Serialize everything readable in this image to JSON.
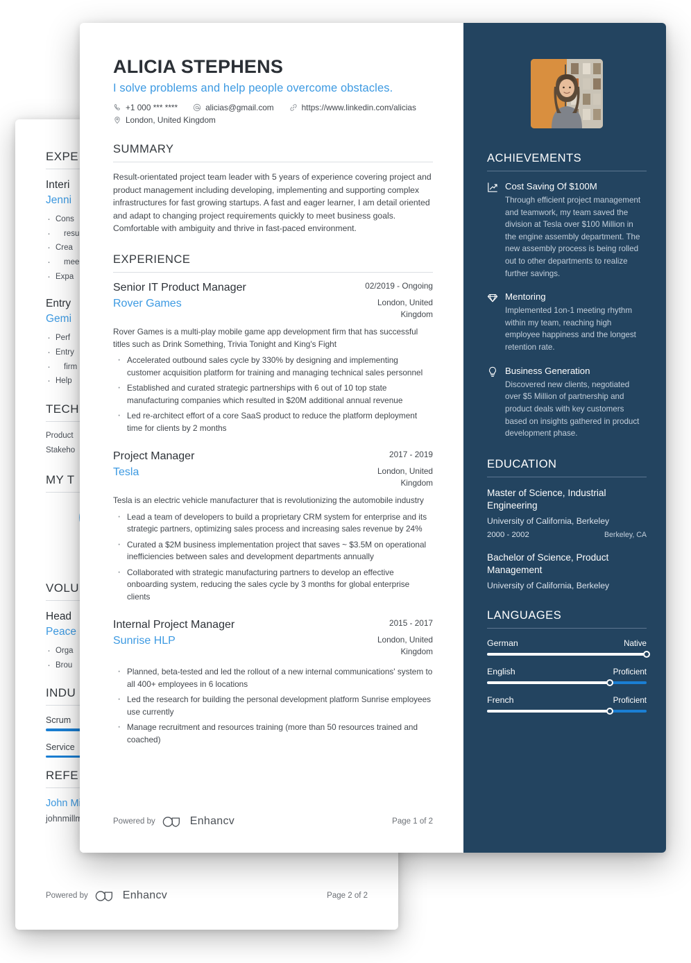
{
  "front_page": {
    "header": {
      "name": "ALICIA STEPHENS",
      "tagline": "I solve problems and help people overcome obstacles.",
      "contacts": [
        {
          "icon": "phone-icon",
          "text": "+1 000 *** ****"
        },
        {
          "icon": "email-icon",
          "text": "alicias@gmail.com"
        },
        {
          "icon": "link-icon",
          "text": "https://www.linkedin.com/alicias"
        },
        {
          "icon": "location-pin-icon",
          "text": "London, United Kingdom"
        }
      ]
    },
    "summary": {
      "heading": "SUMMARY",
      "text": "Result-orientated project team leader with 5 years of experience covering project and product management including developing, implementing and supporting complex infrastructures for fast growing startups. A fast and eager learner, I am detail oriented and adapt to changing project requirements quickly to meet business goals. Comfortable with ambiguity and thrive in fast-paced environment."
    },
    "experience": {
      "heading": "EXPERIENCE",
      "jobs": [
        {
          "title": "Senior IT Product Manager",
          "company": "Rover Games",
          "date": "02/2019 - Ongoing",
          "location": "London, United Kingdom",
          "description": "Rover Games is a multi-play mobile game app development firm that has successful titles such as Drink Something, Trivia Tonight and King's Fight",
          "bullets": [
            "Accelerated outbound sales cycle by 330% by designing and implementing customer acquisition platform for training and managing technical sales personnel",
            "Established and curated strategic partnerships with 6 out of 10 top state manufacturing companies which resulted in $20M additional annual revenue",
            "Led re-architect effort of a core SaaS product to reduce the platform deployment time for clients by 2 months"
          ]
        },
        {
          "title": "Project Manager",
          "company": "Tesla",
          "date": "2017 - 2019",
          "location": "London, United Kingdom",
          "description": "Tesla is an electric vehicle manufacturer that is revolutionizing the automobile industry",
          "bullets": [
            "Lead a team of developers to build a proprietary CRM system for enterprise and its strategic partners, optimizing sales process and increasing sales revenue by 24%",
            "Curated a $2M business implementation project that saves ~ $3.5M on operational inefficiencies between sales and development departments annually",
            "Collaborated with strategic manufacturing partners to develop an effective onboarding system, reducing the sales cycle by 3 months for global enterprise clients"
          ]
        },
        {
          "title": "Internal Project Manager",
          "company": "Sunrise HLP",
          "date": "2015 - 2017",
          "location": "London, United Kingdom",
          "description": "",
          "bullets": [
            "Planned, beta-tested and led the rollout of a new internal communications' system to all 400+ employees in 6 locations",
            "Led the research for building the personal development platform Sunrise employees use currently",
            "Manage recruitment and resources training (more than 50 resources trained and coached)"
          ]
        }
      ]
    },
    "footer": {
      "powered_by": "Powered by",
      "brand": "Enhancv",
      "page": "Page 1 of 2"
    },
    "sidebar": {
      "photo_alt": "profile-photo",
      "achievements": {
        "heading": "ACHIEVEMENTS",
        "items": [
          {
            "icon": "chart-line-icon",
            "title": "Cost Saving Of $100M",
            "text": "Through efficient project management and teamwork, my team saved the division at Tesla over $100 Million in the engine assembly department. The new assembly process is being rolled out to other departments to realize further savings."
          },
          {
            "icon": "diamond-icon",
            "title": "Mentoring",
            "text": "Implemented 1on-1 meeting rhythm within my team, reaching high employee happiness and the longest retention rate."
          },
          {
            "icon": "lightbulb-icon",
            "title": "Business Generation",
            "text": "Discovered new clients, negotiated over $5 Million of partnership and product deals with key customers based on insights gathered in product development phase."
          }
        ]
      },
      "education": {
        "heading": "EDUCATION",
        "items": [
          {
            "degree": "Master of Science, Industrial Engineering",
            "school": "University of California, Berkeley",
            "date": "2000 - 2002",
            "location": "Berkeley, CA"
          },
          {
            "degree": "Bachelor of Science, Product Management",
            "school": "University of California, Berkeley",
            "date": "",
            "location": ""
          }
        ]
      },
      "languages": {
        "heading": "LANGUAGES",
        "items": [
          {
            "name": "German",
            "level": "Native",
            "percent": 100
          },
          {
            "name": "English",
            "level": "Proficient",
            "percent": 77
          },
          {
            "name": "French",
            "level": "Proficient",
            "percent": 77
          }
        ]
      }
    }
  },
  "back_page": {
    "sections": {
      "experience_heading": "EXPE",
      "tech_heading": "TECH",
      "mytime_heading": "MY T",
      "volunteering_heading": "VOLU",
      "industry_heading": "INDU",
      "references_heading": "REFE"
    },
    "jobs": [
      {
        "title": "Interi",
        "company": "Jenni",
        "bullets": [
          "Cons",
          "resu",
          "Crea",
          "mee",
          "Expa"
        ]
      },
      {
        "title": "Entry",
        "company": "Gemi",
        "bullets": [
          "Perf",
          "Entry",
          "firm",
          "Help"
        ]
      }
    ],
    "tech_items": [
      "Product",
      "Stakeho"
    ],
    "volunteer": {
      "title": "Head",
      "company": "Peace",
      "bullets": [
        "Orga",
        "Brou"
      ]
    },
    "industry_items": [
      "Scrum",
      "Service"
    ],
    "reference": {
      "name": "John Millmore",
      "email": "johnmillmore@gmail.com"
    },
    "footer": {
      "powered_by": "Powered by",
      "brand": "Enhancv",
      "page": "Page 2 of 2"
    }
  },
  "colors": {
    "accent_blue": "#3d9ae2",
    "sidebar_navy": "#234460",
    "slider_blue": "#1a7fd4",
    "text_dark": "#2d3238",
    "text_body": "#42474d"
  }
}
